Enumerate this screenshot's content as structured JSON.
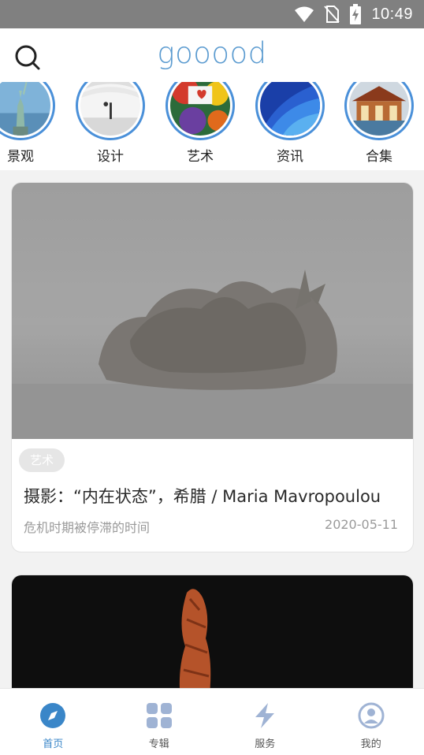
{
  "status_bar": {
    "time": "10:49",
    "icons": [
      "wifi-icon",
      "no-sim-icon",
      "battery-charging-icon"
    ]
  },
  "header": {
    "logo": "gooood",
    "search_icon": "search-icon"
  },
  "categories": [
    {
      "label": "景观",
      "icon": "statue-of-liberty-thumbnail"
    },
    {
      "label": "设计",
      "icon": "white-arches-thumbnail"
    },
    {
      "label": "艺术",
      "icon": "colorful-graffiti-thumbnail"
    },
    {
      "label": "资讯",
      "icon": "blue-dots-thumbnail"
    },
    {
      "label": "合集",
      "icon": "pavilion-thumbnail"
    }
  ],
  "cards": [
    {
      "tag": "艺术",
      "title": "摄影：“内在状态”，希腊 / Maria Mavropoulou",
      "subtitle": "危机时期被停滞的时间",
      "date": "2020-05-11",
      "image": "foggy-uprooted-tree-photo"
    },
    {
      "image": "copper-sculpture-on-black-photo"
    }
  ],
  "bottom_nav": {
    "items": [
      {
        "label": "首页",
        "icon": "compass-icon",
        "active": true
      },
      {
        "label": "专辑",
        "icon": "grid-icon",
        "active": false
      },
      {
        "label": "服务",
        "icon": "lightning-icon",
        "active": false
      },
      {
        "label": "我的",
        "icon": "user-circle-icon",
        "active": false
      }
    ]
  },
  "colors": {
    "accent": "#3a86c8",
    "logo": "#5b9bd0",
    "ring": "#4a90d9",
    "nav_inactive": "#9fb3d4",
    "status_bar": "#808080"
  }
}
